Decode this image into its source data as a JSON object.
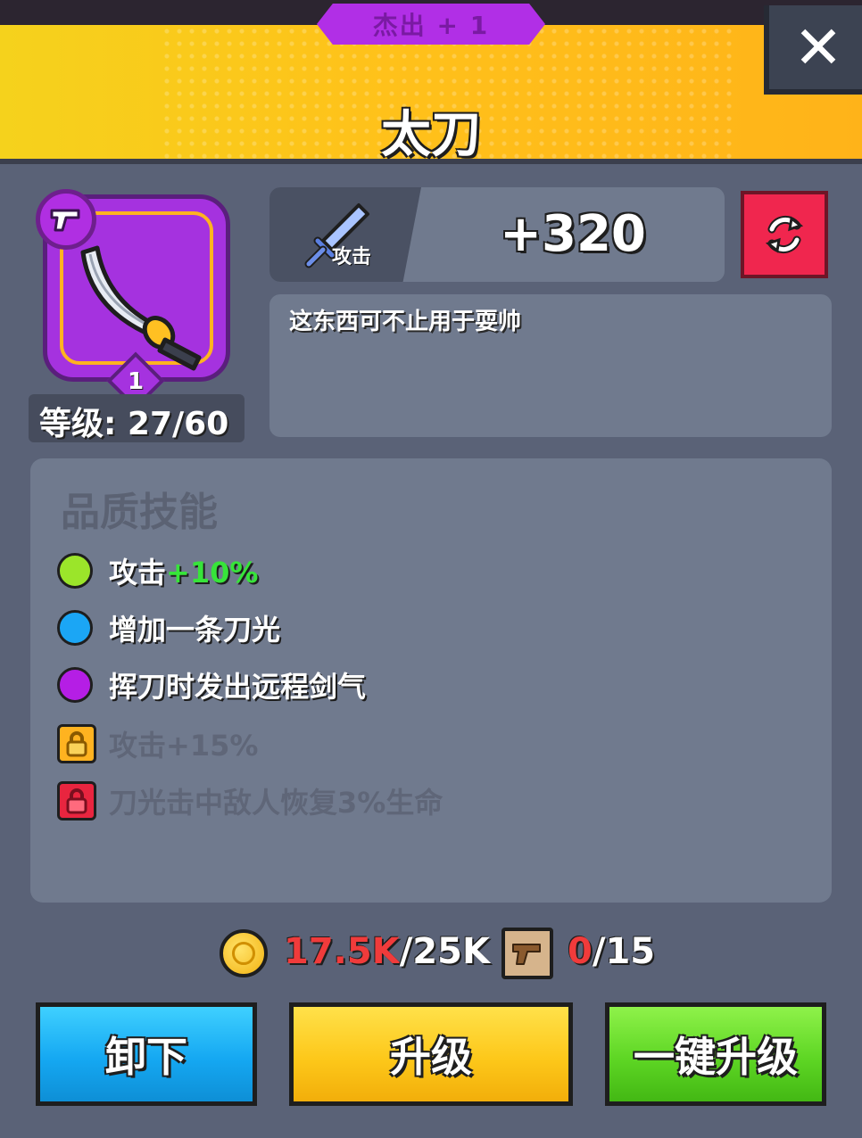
{
  "header": {
    "rarity_label": "杰出 + 1",
    "title": "太刀",
    "close_symbol": "✕"
  },
  "item": {
    "level_badge": "1",
    "level_label": "等级: 27/60",
    "icon": "katana-icon",
    "type_icon": "pistol-icon",
    "rarity_color": "#a532df"
  },
  "stat": {
    "icon": "sword-icon",
    "label": "攻击",
    "value": "+320"
  },
  "refresh_icon": "refresh-icon",
  "description": "这东西可不止用于耍帅",
  "skills": {
    "title": "品质技能",
    "items": [
      {
        "label": "攻击",
        "bonus": "+10%",
        "color": "#9be52a",
        "locked": false
      },
      {
        "label": "增加一条刀光",
        "bonus": "",
        "color": "#1ba6f5",
        "locked": false
      },
      {
        "label": "挥刀时发出远程剑气",
        "bonus": "",
        "color": "#b51ee5",
        "locked": false
      },
      {
        "label": "攻击+15%",
        "bonus": "",
        "color": "#ffb320",
        "locked": true
      },
      {
        "label": "刀光击中敌人恢复3%生命",
        "bonus": "",
        "color": "#e9253f",
        "locked": true
      }
    ]
  },
  "resources": {
    "gold_current": "17.5K",
    "gold_separator": "/",
    "gold_required": "25K",
    "scroll_current": "0",
    "scroll_separator": "/",
    "scroll_required": "15"
  },
  "buttons": {
    "unequip": "卸下",
    "upgrade": "升级",
    "one_click_upgrade": "一键升级"
  }
}
